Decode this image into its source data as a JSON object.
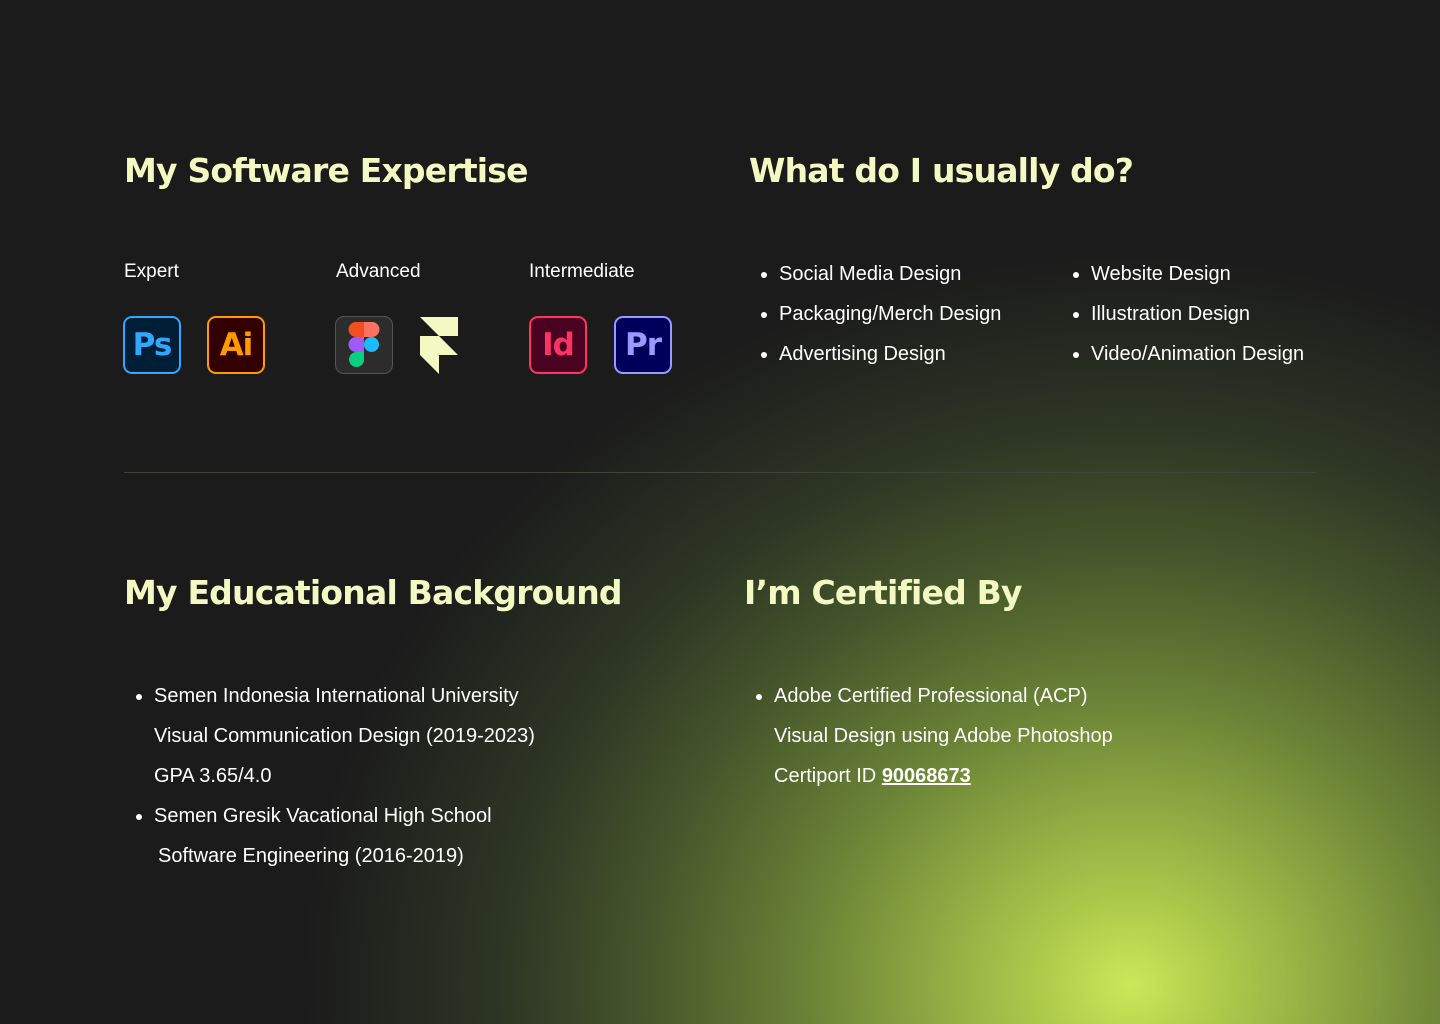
{
  "software": {
    "title": "My Software Expertise",
    "levels": [
      {
        "label": "Expert",
        "apps": [
          {
            "abbr": "Ps"
          },
          {
            "abbr": "Ai"
          }
        ]
      },
      {
        "label": "Advanced",
        "apps": [
          {
            "icon": "figma-icon"
          },
          {
            "icon": "framer-icon"
          }
        ]
      },
      {
        "label": "Intermediate",
        "apps": [
          {
            "abbr": "Id"
          },
          {
            "abbr": "Pr"
          }
        ]
      }
    ]
  },
  "services": {
    "title": "What do I usually do?",
    "col1": [
      "Social Media Design",
      "Packaging/Merch Design",
      "Advertising Design"
    ],
    "col2": [
      "Website Design",
      "Illustration Design",
      "Video/Animation Design"
    ]
  },
  "education": {
    "title": "My Educational Background",
    "lines": [
      "Semen Indonesia International University",
      "Visual Communication Design (2019-2023)",
      "GPA 3.65/4.0",
      "Semen Gresik Vacational High School",
      "Software Engineering (2016-2019)"
    ]
  },
  "certification": {
    "title": "I’m Certified By",
    "lines": [
      "Adobe Certified Professional (ACP)",
      "Visual Design using Adobe Photoshop"
    ],
    "id_prefix": "Certiport ID ",
    "id_value": "90068673"
  },
  "colors": {
    "background": "#1b1b1b",
    "heading": "#f3f9c3",
    "glow": "#cbe85a"
  }
}
